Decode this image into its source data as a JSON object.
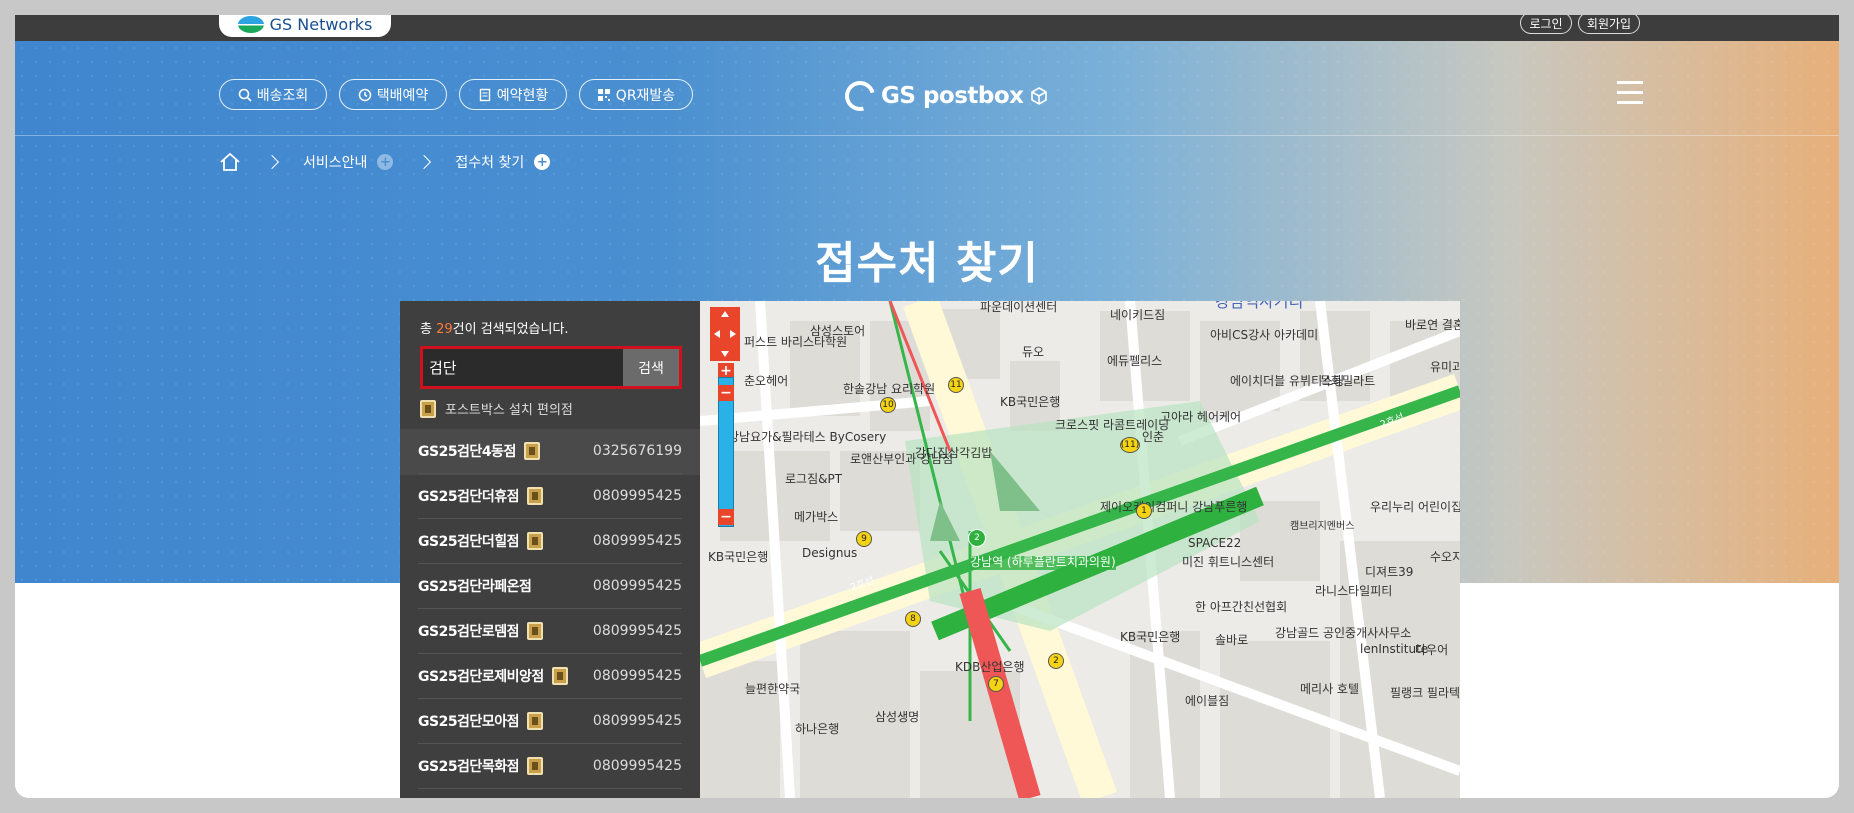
{
  "header": {
    "gs_logo_text": "GS Networks",
    "login_label": "로그인",
    "join_label": "회원가입"
  },
  "nav": {
    "items": [
      {
        "label": "배송조회",
        "icon": "search-icon"
      },
      {
        "label": "택배예약",
        "icon": "clock-icon"
      },
      {
        "label": "예약현황",
        "icon": "document-icon"
      },
      {
        "label": "QR재발송",
        "icon": "qr-icon"
      }
    ],
    "brand": "GS postbox"
  },
  "breadcrumb": {
    "items": [
      {
        "label": "서비스안내"
      },
      {
        "label": "접수처 찾기"
      }
    ]
  },
  "page": {
    "title": "접수처 찾기"
  },
  "panel": {
    "count_prefix": "총 ",
    "count_value": "29",
    "count_suffix": "건이 검색되었습니다.",
    "search_value": "검단",
    "search_button": "검색",
    "legend_label": "포스트박스 설치 편의점",
    "stores": [
      {
        "name": "GS25검단4동점",
        "phone": "0325676199",
        "postbox": true
      },
      {
        "name": "GS25검단더휴점",
        "phone": "0809995425",
        "postbox": true
      },
      {
        "name": "GS25검단더힐점",
        "phone": "0809995425",
        "postbox": true
      },
      {
        "name": "GS25검단라페온점",
        "phone": "0809995425",
        "postbox": false
      },
      {
        "name": "GS25검단로뎀점",
        "phone": "0809995425",
        "postbox": true
      },
      {
        "name": "GS25검단로제비앙점",
        "phone": "0809995425",
        "postbox": true
      },
      {
        "name": "GS25검단모아점",
        "phone": "0809995425",
        "postbox": true
      },
      {
        "name": "GS25검단목화점",
        "phone": "0809995425",
        "postbox": true
      }
    ]
  },
  "map": {
    "labels": [
      "파운데이션센터",
      "네이키드짐",
      "강남역사거리",
      "바로연 결혼정보",
      "삼성스토어",
      "퍼스트 바리스타학원",
      "듀오",
      "에듀펠리스",
      "아비CS강사 아카데미",
      "유미과 문화재",
      "춘오헤어",
      "한솔강남 요리학원",
      "KB국민은행",
      "에이치더블 유뷔티스팅",
      "목화밀라트",
      "강남요가&필라테스 ByCosery",
      "로앤산부인과 강남점",
      "강다짐삼각김밥",
      "크로스핏 라콤트레이닝",
      "고아라 헤어케어",
      "인춘",
      "로그짐&PT",
      "메가박스",
      "제이오케이컴퍼니 강남푸른행",
      "우리누리 어린이집",
      "캠브리지멘버스",
      "KB국민은행",
      "Designus",
      "SPACE22",
      "미진 휘트니스센터",
      "디져트39",
      "수오지",
      "강남역 (하루플란트치과의원)",
      "2호선",
      "2호선",
      "라니스타일피티",
      "한 아프간친선협회",
      "KB국민은행",
      "솔바로",
      "강남골드 공인중개사사무소",
      "lenInstitute",
      "다우어",
      "KDB산업은행",
      "늘편한약국",
      "에이블짐",
      "메리사 호텔",
      "필랭크 필라텍스",
      "하나은행",
      "삼성생명"
    ],
    "stations": [
      "10",
      "11",
      "9",
      "8",
      "7",
      "2",
      "1",
      "(11)",
      "2"
    ]
  }
}
